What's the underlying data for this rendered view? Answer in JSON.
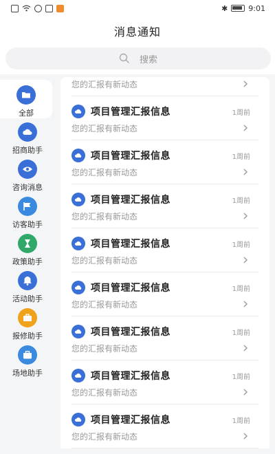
{
  "status_bar": {
    "time": "9:01",
    "left_icons": [
      "sim-icon",
      "wifi-icon",
      "vpn-icon",
      "mail-icon",
      "orange-app-icon"
    ],
    "right_icons": [
      "bluetooth-icon",
      "battery-icon"
    ]
  },
  "header": {
    "title": "消息通知"
  },
  "search": {
    "placeholder": "搜索"
  },
  "sidebar": {
    "items": [
      {
        "label": "全部",
        "icon": "folder-icon",
        "color": "#3a6fd8",
        "active": true
      },
      {
        "label": "招商助手",
        "icon": "cloud-icon",
        "color": "#3a6fd8",
        "active": false
      },
      {
        "label": "咨询消息",
        "icon": "eye-icon",
        "color": "#3a6fd8",
        "active": false
      },
      {
        "label": "访客助手",
        "icon": "flag-icon",
        "color": "#3a8be0",
        "active": false
      },
      {
        "label": "政策助手",
        "icon": "hourglass-icon",
        "color": "#2fa86a",
        "active": false
      },
      {
        "label": "活动助手",
        "icon": "bell-icon",
        "color": "#3a6fd8",
        "active": false
      },
      {
        "label": "报修助手",
        "icon": "toolbox-icon",
        "color": "#f0a21c",
        "active": false
      },
      {
        "label": "场地助手",
        "icon": "briefcase-icon",
        "color": "#3a8be0",
        "active": false
      }
    ]
  },
  "messages": {
    "partial": {
      "desc": "您的汇报有新动态"
    },
    "items": [
      {
        "title": "项目管理汇报信息",
        "time": "1周前",
        "desc": "您的汇报有新动态"
      },
      {
        "title": "项目管理汇报信息",
        "time": "1周前",
        "desc": "您的汇报有新动态"
      },
      {
        "title": "项目管理汇报信息",
        "time": "1周前",
        "desc": "您的汇报有新动态"
      },
      {
        "title": "项目管理汇报信息",
        "time": "1周前",
        "desc": "您的汇报有新动态"
      },
      {
        "title": "项目管理汇报信息",
        "time": "1周前",
        "desc": "您的汇报有新动态"
      },
      {
        "title": "项目管理汇报信息",
        "time": "1周前",
        "desc": "您的汇报有新动态"
      },
      {
        "title": "项目管理汇报信息",
        "time": "1周前",
        "desc": "您的汇报有新动态"
      },
      {
        "title": "项目管理汇报信息",
        "time": "1周前",
        "desc": "您的汇报有新动态"
      }
    ]
  },
  "colors": {
    "accent": "#3a6fd8",
    "background": "#f4f5f7",
    "muted_text": "#999999"
  }
}
